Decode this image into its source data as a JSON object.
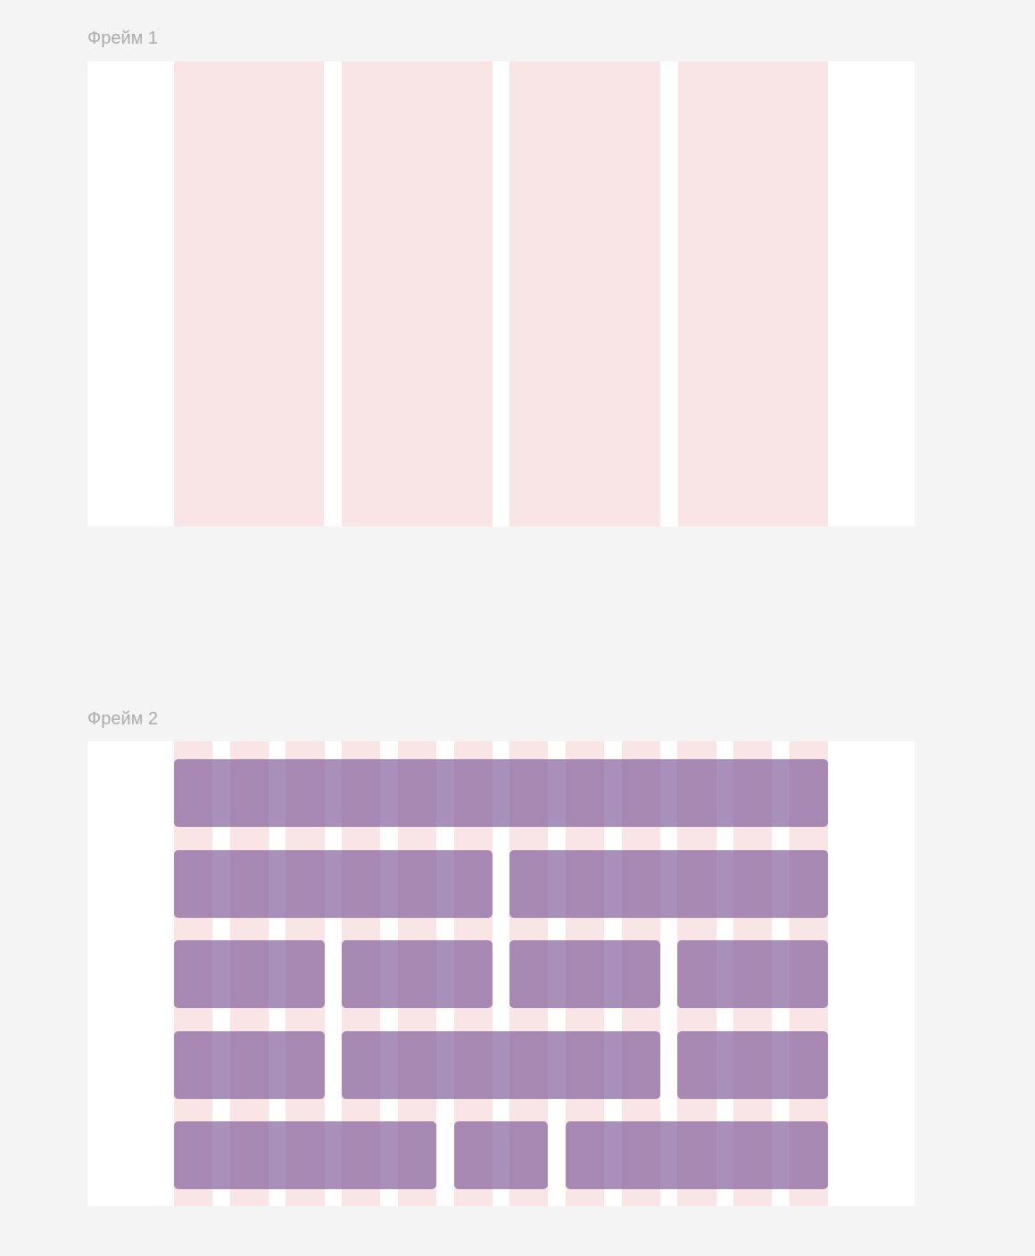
{
  "frames": [
    {
      "label": "Фрейм 1"
    },
    {
      "label": "Фрейм 2"
    }
  ],
  "grid": {
    "frame_1_columns": 4,
    "frame_2_columns": 12,
    "colors": {
      "canvas_background": "#f4f4f4",
      "frame_background": "#ffffff",
      "column_fill": "#f9e5e5",
      "block_fill": "#a68eb3",
      "label_color": "#ababab"
    }
  },
  "layout_rows": [
    {
      "spans": [
        12
      ]
    },
    {
      "spans": [
        6,
        6
      ]
    },
    {
      "spans": [
        3,
        3,
        3,
        3
      ]
    },
    {
      "spans": [
        3,
        6,
        3
      ]
    },
    {
      "spans": [
        5,
        2,
        5
      ]
    }
  ]
}
